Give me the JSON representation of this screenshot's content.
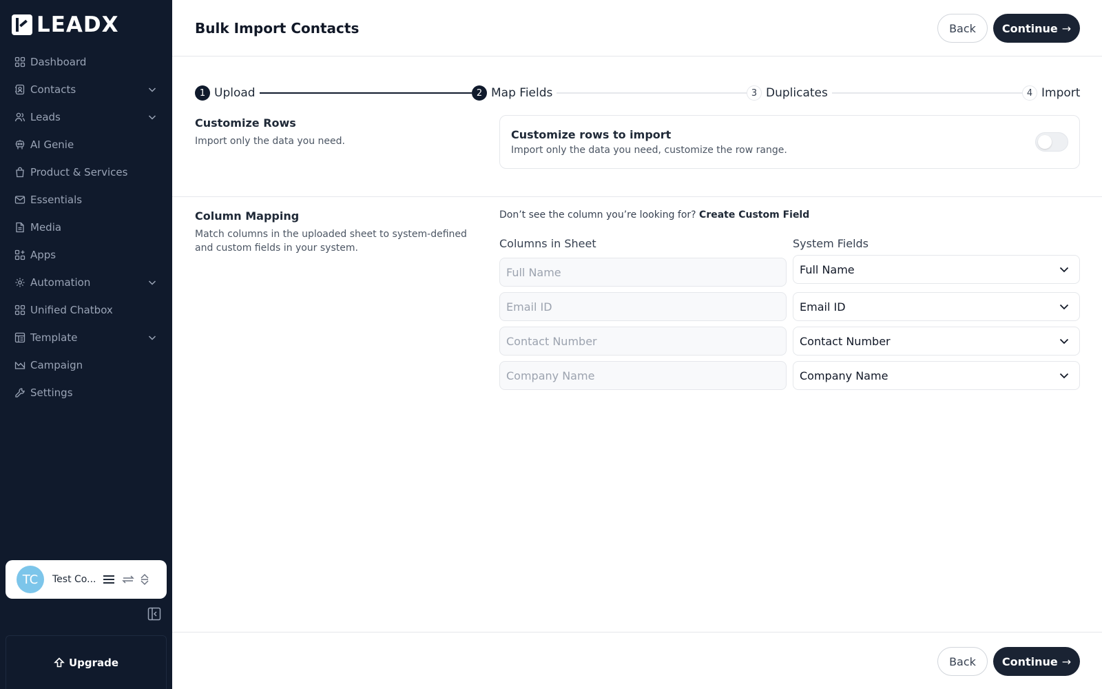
{
  "brand": {
    "name": "LEADX"
  },
  "sidebar": {
    "items": [
      {
        "label": "Dashboard",
        "icon": "dashboard-icon",
        "has_chevron": false
      },
      {
        "label": "Contacts",
        "icon": "contacts-icon",
        "has_chevron": true
      },
      {
        "label": "Leads",
        "icon": "leads-icon",
        "has_chevron": true
      },
      {
        "label": "AI Genie",
        "icon": "ai-genie-icon",
        "has_chevron": false
      },
      {
        "label": "Product & Services",
        "icon": "bag-icon",
        "has_chevron": false
      },
      {
        "label": "Essentials",
        "icon": "mail-icon",
        "has_chevron": false
      },
      {
        "label": "Media",
        "icon": "document-icon",
        "has_chevron": false
      },
      {
        "label": "Apps",
        "icon": "apps-icon",
        "has_chevron": false
      },
      {
        "label": "Automation",
        "icon": "automation-gear-icon",
        "has_chevron": true
      },
      {
        "label": "Unified Chatbox",
        "icon": "chatbox-grid-icon",
        "has_chevron": false
      },
      {
        "label": "Template",
        "icon": "template-icon",
        "has_chevron": true
      },
      {
        "label": "Campaign",
        "icon": "campaign-icon",
        "has_chevron": false
      },
      {
        "label": "Settings",
        "icon": "settings-icon",
        "has_chevron": false
      }
    ],
    "profile": {
      "initials": "TC",
      "name": "Test Co..."
    },
    "upgrade_label": "Upgrade"
  },
  "header": {
    "title": "Bulk Import Contacts",
    "back_label": "Back",
    "continue_label": "Continue",
    "continue_arrow": "→"
  },
  "stepper": {
    "steps": [
      {
        "num": "1",
        "label": "Upload",
        "state": "done"
      },
      {
        "num": "2",
        "label": "Map Fields",
        "state": "active"
      },
      {
        "num": "3",
        "label": "Duplicates",
        "state": "pending"
      },
      {
        "num": "4",
        "label": "Import",
        "state": "pending"
      }
    ]
  },
  "customize_rows": {
    "title": "Customize Rows",
    "desc": "Import only the data you need.",
    "card_title": "Customize rows to import",
    "card_desc": "Import only the data you need, customize the row range.",
    "toggle_on": false
  },
  "column_mapping": {
    "title": "Column Mapping",
    "desc_line1": "Match columns in the uploaded sheet to system-defined",
    "desc_line2": "and custom fields in your system.",
    "hint_text": "Don’t see the column you’re looking for?",
    "hint_link": "Create Custom Field",
    "sheet_header": "Columns in Sheet",
    "system_header": "System Fields",
    "rows": [
      {
        "sheet_placeholder": "Full Name",
        "system_value": "Full Name"
      },
      {
        "sheet_placeholder": "Email ID",
        "system_value": "Email ID"
      },
      {
        "sheet_placeholder": "Contact Number",
        "system_value": "Contact Number"
      },
      {
        "sheet_placeholder": "Company Name",
        "system_value": "Company Name"
      }
    ]
  },
  "footer": {
    "back_label": "Back",
    "continue_label": "Continue",
    "continue_arrow": "→"
  },
  "colors": {
    "sidebar_bg": "#101a2c",
    "primary_button": "#1a2333",
    "avatar": "#7cc5ea"
  }
}
